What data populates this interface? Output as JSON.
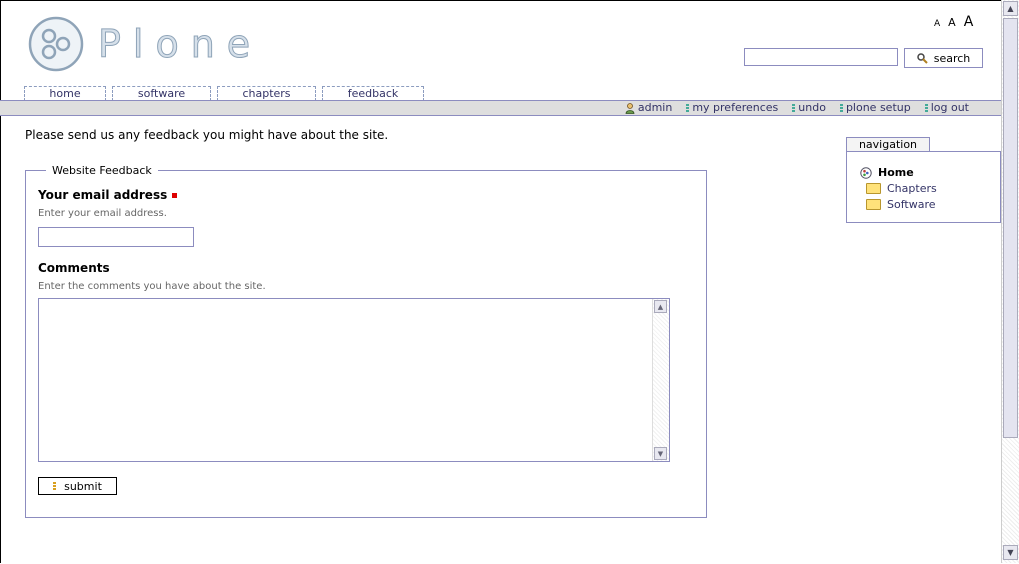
{
  "logo": {
    "text": "Plone"
  },
  "text_size": {
    "small": "A",
    "medium": "A",
    "large": "A"
  },
  "search": {
    "input_value": "",
    "button_label": "search"
  },
  "tabs": [
    {
      "label": "home"
    },
    {
      "label": "software"
    },
    {
      "label": "chapters"
    },
    {
      "label": "feedback"
    }
  ],
  "personal_bar": {
    "items": [
      {
        "label": "admin"
      },
      {
        "label": "my preferences"
      },
      {
        "label": "undo"
      },
      {
        "label": "plone setup"
      },
      {
        "label": "log out"
      }
    ]
  },
  "intro": "Please send us any feedback you might have about the site.",
  "form": {
    "legend": "Website Feedback",
    "email": {
      "label": "Your email address",
      "help": "Enter your email address.",
      "value": ""
    },
    "comments": {
      "label": "Comments",
      "help": "Enter the comments you have about the site.",
      "value": ""
    },
    "submit_label": "submit"
  },
  "navigation": {
    "title": "navigation",
    "items": [
      {
        "label": "Home"
      },
      {
        "label": "Chapters"
      },
      {
        "label": "Software"
      }
    ]
  },
  "colors": {
    "border": "#8c8cbf",
    "link": "#333366",
    "bar": "#dedede",
    "required": "#dd0000"
  }
}
